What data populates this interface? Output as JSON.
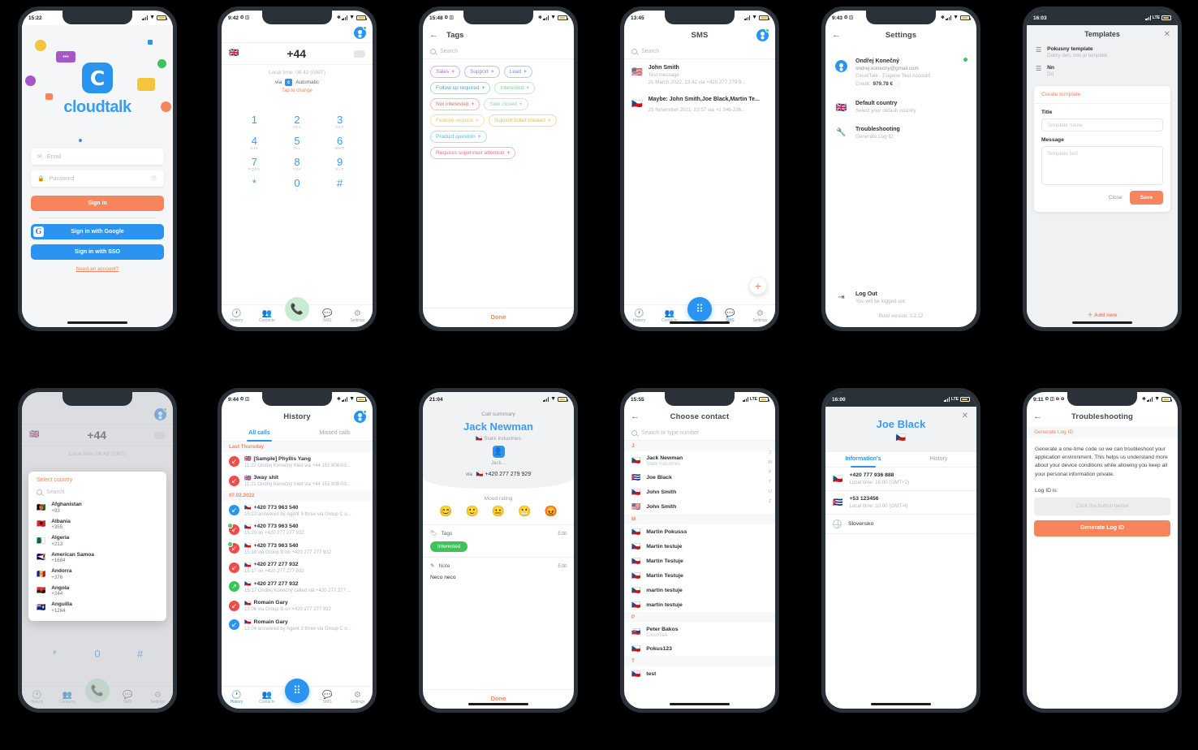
{
  "screens": {
    "login": {
      "status_time": "15:22",
      "logo_letter": "C",
      "brand": "cloudtalk",
      "email_placeholder": "Email",
      "password_placeholder": "Password",
      "sign_in": "Sign in",
      "sign_in_google": "Sign in with Google",
      "google_letter": "G",
      "sign_in_sso": "Sign in with SSO",
      "need_account": "Need an account?"
    },
    "dialer": {
      "status_time": "9:42",
      "flag": "🇬🇧",
      "number": "+44",
      "local_time": "Local time: 08:42  (GMT)",
      "via_label": "via",
      "via_badge": "c",
      "via_value": "Automatic",
      "tap_to_change": "Tap to change",
      "keys": [
        {
          "d": "1",
          "l": ""
        },
        {
          "d": "2",
          "l": "ABC"
        },
        {
          "d": "3",
          "l": "DEF"
        },
        {
          "d": "4",
          "l": "GHI"
        },
        {
          "d": "5",
          "l": "JKL"
        },
        {
          "d": "6",
          "l": "MNO"
        },
        {
          "d": "7",
          "l": "PQRS"
        },
        {
          "d": "8",
          "l": "TUV"
        },
        {
          "d": "9",
          "l": "XYZ"
        },
        {
          "d": "*",
          "l": ""
        },
        {
          "d": "0",
          "l": "+"
        },
        {
          "d": "#",
          "l": ""
        }
      ],
      "tabs": [
        "History",
        "Contacts",
        "SMS",
        "Settings"
      ]
    },
    "tags": {
      "status_time": "15:48",
      "title": "Tags",
      "search_placeholder": "Search",
      "items": [
        {
          "label": "Sales",
          "color": "#b566d6"
        },
        {
          "label": "Support",
          "color": "#8a7fe0"
        },
        {
          "label": "Lead",
          "color": "#6d8fe8"
        },
        {
          "label": "Follow up required",
          "color": "#4aa8e8"
        },
        {
          "label": "Interested",
          "color": "#7ecf9a"
        },
        {
          "label": "Not interested",
          "color": "#ef6b6b"
        },
        {
          "label": "Sale closed",
          "color": "#8fd6a8"
        },
        {
          "label": "Feature request",
          "color": "#f2c759"
        },
        {
          "label": "Support ticket created",
          "color": "#f0b84a"
        },
        {
          "label": "Product question",
          "color": "#46c3e0"
        },
        {
          "label": "Requires supervisor attention",
          "color": "#ef6b8a"
        }
      ],
      "done": "Done"
    },
    "sms": {
      "status_time": "13:45",
      "title": "SMS",
      "search_placeholder": "Search",
      "items": [
        {
          "flag": "🇺🇸",
          "name": "John Smith",
          "preview": "Test message",
          "meta": "21 March 2022, 13:42  via +420 277 279 9..."
        },
        {
          "flag": "🇨🇿",
          "name": "Maybe: John Smith,Joe Black,Martin Te...",
          "preview": "",
          "meta": "25 November 2021, 23:57  via +1 346-226..."
        }
      ],
      "add_icon": "+",
      "tabs": [
        "History",
        "Contacts",
        "SMS",
        "Settings"
      ]
    },
    "settings": {
      "status_time": "9:43",
      "title": "Settings",
      "account": {
        "name": "Ondřej Konečný",
        "email": "ondrej.konecny@gmail.com",
        "org": "CloudTalk - Eugene Test Account",
        "credit_label": "Credit:",
        "credit_value": "979.78 €"
      },
      "rows": [
        {
          "icon": "🇬🇧",
          "title": "Default country",
          "sub": "Select your default country"
        },
        {
          "icon": "🔧",
          "title": "Troubleshooting",
          "sub": "Generate Log ID"
        }
      ],
      "logout": {
        "title": "Log Out",
        "sub": "You will be logged out"
      },
      "build": "Build version: 3.2.12"
    },
    "templates": {
      "status_time": "16:03",
      "title": "Templates",
      "close_icon": "✕",
      "items": [
        {
          "title": "Pokusny template",
          "sub": "Dobry den, toto je template"
        },
        {
          "title": "Nn",
          "sub": "Dd"
        }
      ],
      "card_title": "Create template",
      "title_label": "Title",
      "title_placeholder": "Template name",
      "message_label": "Message",
      "message_placeholder": "Template text",
      "close_btn": "Close",
      "save_btn": "Save",
      "add_new": "＋ Add new"
    },
    "country": {
      "flag": "🇬🇧",
      "number": "+44",
      "local_time": "Local time: 08:43  (GMT)",
      "sheet_title": "Select country",
      "search_placeholder": "Search",
      "countries": [
        {
          "flag": "🇦🇫",
          "name": "Afghanistan",
          "dial": "+93"
        },
        {
          "flag": "🇦🇱",
          "name": "Albania",
          "dial": "+355"
        },
        {
          "flag": "🇩🇿",
          "name": "Algeria",
          "dial": "+213"
        },
        {
          "flag": "🇦🇸",
          "name": "American Samoa",
          "dial": "+1684"
        },
        {
          "flag": "🇦🇩",
          "name": "Andorra",
          "dial": "+376"
        },
        {
          "flag": "🇦🇴",
          "name": "Angola",
          "dial": "+244"
        },
        {
          "flag": "🇦🇮",
          "name": "Anguilla",
          "dial": "+1264"
        }
      ],
      "keys": [
        "*",
        "0",
        "#"
      ],
      "tabs": [
        "History",
        "Contacts",
        "SMS",
        "Settings"
      ]
    },
    "history": {
      "status_time": "9:44",
      "title": "History",
      "tab_all": "All calls",
      "tab_missed": "Missed calls",
      "groups": [
        {
          "day": "Last Thursday",
          "calls": [
            {
              "dir": "missed",
              "flag": "🇬🇧",
              "name": "[Sample] Phyllis Yang",
              "meta": "11:22 Ondřej Konečný tried via +44 151 808-03..."
            },
            {
              "dir": "missed",
              "flag": "🇬🇧",
              "name": "3way shit",
              "meta": "11:21 Ondřej Konečný tried via +44 151 808-03..."
            }
          ]
        },
        {
          "day": "07.02.2022",
          "calls": [
            {
              "dir": "in",
              "flag": "🇨🇿",
              "name": "+420 773 963 540",
              "meta": "15:23 answered by Agent 3 three via Group C o..."
            },
            {
              "dir": "missed-ok",
              "flag": "🇨🇿",
              "name": "+420 773 963 540",
              "meta": "15:20 on +420 277 277 932"
            },
            {
              "dir": "missed-ok",
              "flag": "🇨🇿",
              "name": "+420 773 963 540",
              "meta": "15:18 via Group B on +420 277 277 932"
            },
            {
              "dir": "missed",
              "flag": "🇨🇿",
              "name": "+420 277 277 932",
              "meta": "15:17 on +420 277 277 932"
            },
            {
              "dir": "out",
              "flag": "🇨🇿",
              "name": "+420 277 277 932",
              "meta": "15:17 Ondřej Konečný called via +420 277 277 ..."
            },
            {
              "dir": "missed",
              "flag": "🇨🇿",
              "name": "Romain Gary",
              "meta": "13:06 via Group B on +420 277 277 932"
            },
            {
              "dir": "in",
              "flag": "🇨🇿",
              "name": "Romain Gary",
              "meta": "13:04 answered by Agent 3 three via Group C o..."
            }
          ]
        }
      ],
      "tabs": [
        "History",
        "Contacts",
        "SMS",
        "Settings"
      ]
    },
    "summary": {
      "status_time": "21:04",
      "label": "Call summary",
      "name": "Jack Newman",
      "flag": "🇨🇿",
      "company": "Stark Industries",
      "avatar_sub": "Jack...",
      "via_label": "via",
      "via_flag": "🇨🇿",
      "via_number": "+420 277 279 929",
      "mood_label": "Mood rating",
      "moods": [
        "😊",
        "🙂",
        "😐",
        "😬",
        "😡"
      ],
      "tags_label": "Tags",
      "tags_edit": "Edit",
      "tag_value": "Interested",
      "note_label": "Note",
      "note_edit": "Edit",
      "note_value": "Neco neco",
      "done": "Done"
    },
    "choose_contact": {
      "status_time": "15:55",
      "title": "Choose contact",
      "search_placeholder": "Search or type number",
      "index": [
        "J",
        "M",
        "P",
        "T",
        "U",
        "Z"
      ],
      "sections": [
        {
          "letter": "J",
          "contacts": [
            {
              "flag": "🇨🇿",
              "name": "Jack Newman",
              "sub": "Stark Industries"
            },
            {
              "flag": "🇨🇺",
              "name": "Joe Black",
              "sub": ""
            },
            {
              "flag": "🇨🇿",
              "name": "John Smith",
              "sub": ""
            },
            {
              "flag": "🇺🇸",
              "name": "John Smith",
              "sub": ""
            }
          ]
        },
        {
          "letter": "M",
          "contacts": [
            {
              "flag": "🇨🇿",
              "name": "Martin Pokusss",
              "sub": ""
            },
            {
              "flag": "🇨🇿",
              "name": "Martin testuje",
              "sub": ""
            },
            {
              "flag": "🇨🇿",
              "name": "Martin Testuje",
              "sub": ""
            },
            {
              "flag": "🇨🇿",
              "name": "Martin Testuje",
              "sub": ""
            },
            {
              "flag": "🇨🇿",
              "name": "martin testuje",
              "sub": ""
            },
            {
              "flag": "🇨🇿",
              "name": "martin testuje",
              "sub": ""
            }
          ]
        },
        {
          "letter": "P",
          "contacts": [
            {
              "flag": "🇸🇰",
              "name": "Peter Bakos",
              "sub": "CloudTalk"
            },
            {
              "flag": "🇨🇿",
              "name": "Pokus123",
              "sub": ""
            }
          ]
        },
        {
          "letter": "T",
          "contacts": [
            {
              "flag": "🇨🇿",
              "name": "test",
              "sub": ""
            }
          ]
        }
      ]
    },
    "contact_detail": {
      "status_time": "16:00",
      "close_icon": "✕",
      "name": "Joe Black",
      "flag": "🇨🇿",
      "tab_info": "Information's",
      "tab_history": "History",
      "numbers": [
        {
          "flag": "🇨🇿",
          "number": "+420 777 936 888",
          "local": "Local time: 16:00  (GMT+2)"
        },
        {
          "flag": "🇨🇺",
          "number": "+53 123456",
          "local": "Local time: 10:00  (GMT-4)"
        }
      ],
      "country": "Slovensko"
    },
    "troubleshooting": {
      "status_time": "9:11",
      "title": "Troubleshooting",
      "section": "Generate Log ID",
      "paragraph": "Generate a one-time code so we can troubleshoot your application environment. This helps us understand more about your device conditions while allowing you keep all your personal information private.",
      "logid_label": "Log ID is:",
      "logid_placeholder": "Click the button below",
      "button": "Generate Log ID"
    }
  },
  "colors": {
    "accent_orange": "#f8845e",
    "accent_blue": "#2b93f0",
    "green": "#3ec25a",
    "red": "#ef4b4b",
    "text_dark": "#2a2f36",
    "text_muted": "#b0b7bf",
    "frame": "#2b3138"
  }
}
